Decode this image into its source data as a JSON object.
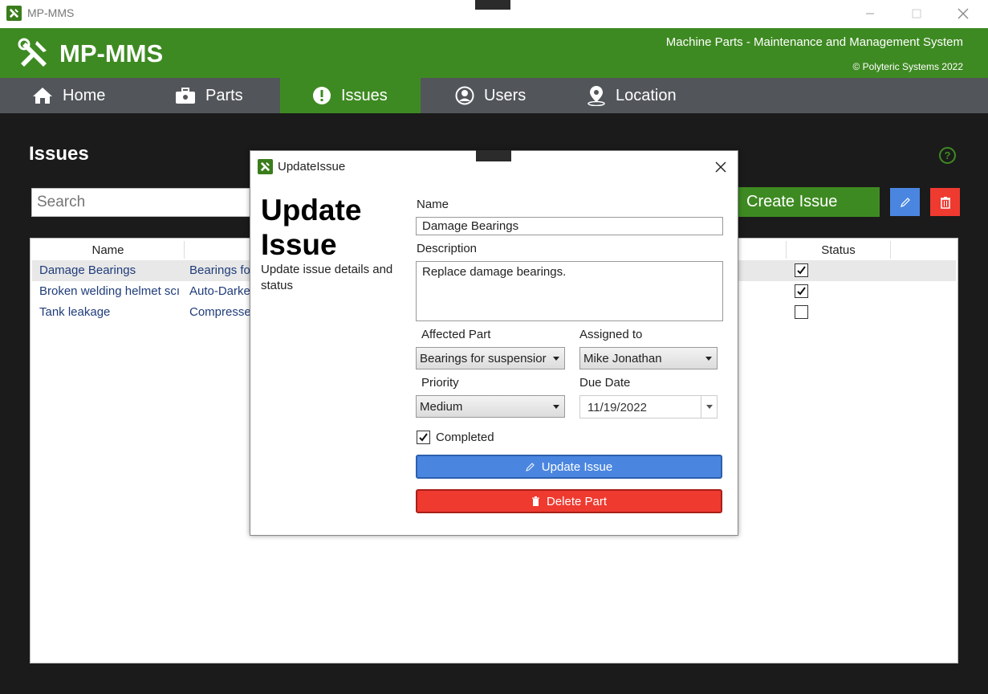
{
  "window": {
    "title": "MP-MMS",
    "icon": "tools-icon",
    "controls": [
      "minimize",
      "maximize",
      "close"
    ]
  },
  "header": {
    "brand": "MP-MMS",
    "subtitle": "Machine Parts - Maintenance and Management System",
    "copyright": "© Polyteric Systems 2022",
    "color": "#3e8a22"
  },
  "nav": {
    "items": [
      {
        "label": "Home",
        "icon": "home-icon"
      },
      {
        "label": "Parts",
        "icon": "toolbox-icon"
      },
      {
        "label": "Issues",
        "icon": "exclamation-icon",
        "active": true
      },
      {
        "label": "Users",
        "icon": "user-icon"
      },
      {
        "label": "Location",
        "icon": "location-icon"
      }
    ]
  },
  "page": {
    "title": "Issues",
    "search_placeholder": "Search",
    "create_label": "Create Issue"
  },
  "table": {
    "columns": [
      "Name",
      "Status"
    ],
    "rows": [
      {
        "name": "Damage Bearings",
        "part": "Bearings fo",
        "status": true
      },
      {
        "name": "Broken welding helmet scı",
        "part": "Auto-Darke",
        "status": true
      },
      {
        "name": "Tank leakage",
        "part": "Compressec",
        "status": false
      }
    ]
  },
  "dialog": {
    "window_title": "UpdateIssue",
    "heading": "Update Issue",
    "description": "Update issue details and status",
    "name_label": "Name",
    "name_value": "Damage Bearings",
    "desc_label": "Description",
    "desc_value": "Replace damage bearings.",
    "part_label": "Affected Part",
    "part_value": "Bearings for suspensior",
    "assigned_label": "Assigned to",
    "assigned_value": "Mike Jonathan",
    "priority_label": "Priority",
    "priority_value": "Medium",
    "due_label": "Due Date",
    "due_value": "11/19/2022",
    "completed_label": "Completed",
    "completed": true,
    "update_label": "Update Issue",
    "delete_label": "Delete Part"
  },
  "colors": {
    "accent": "#3e8a22",
    "nav_bg": "#52565a",
    "primary_button": "#4a86e0",
    "danger_button": "#ef3a30"
  }
}
